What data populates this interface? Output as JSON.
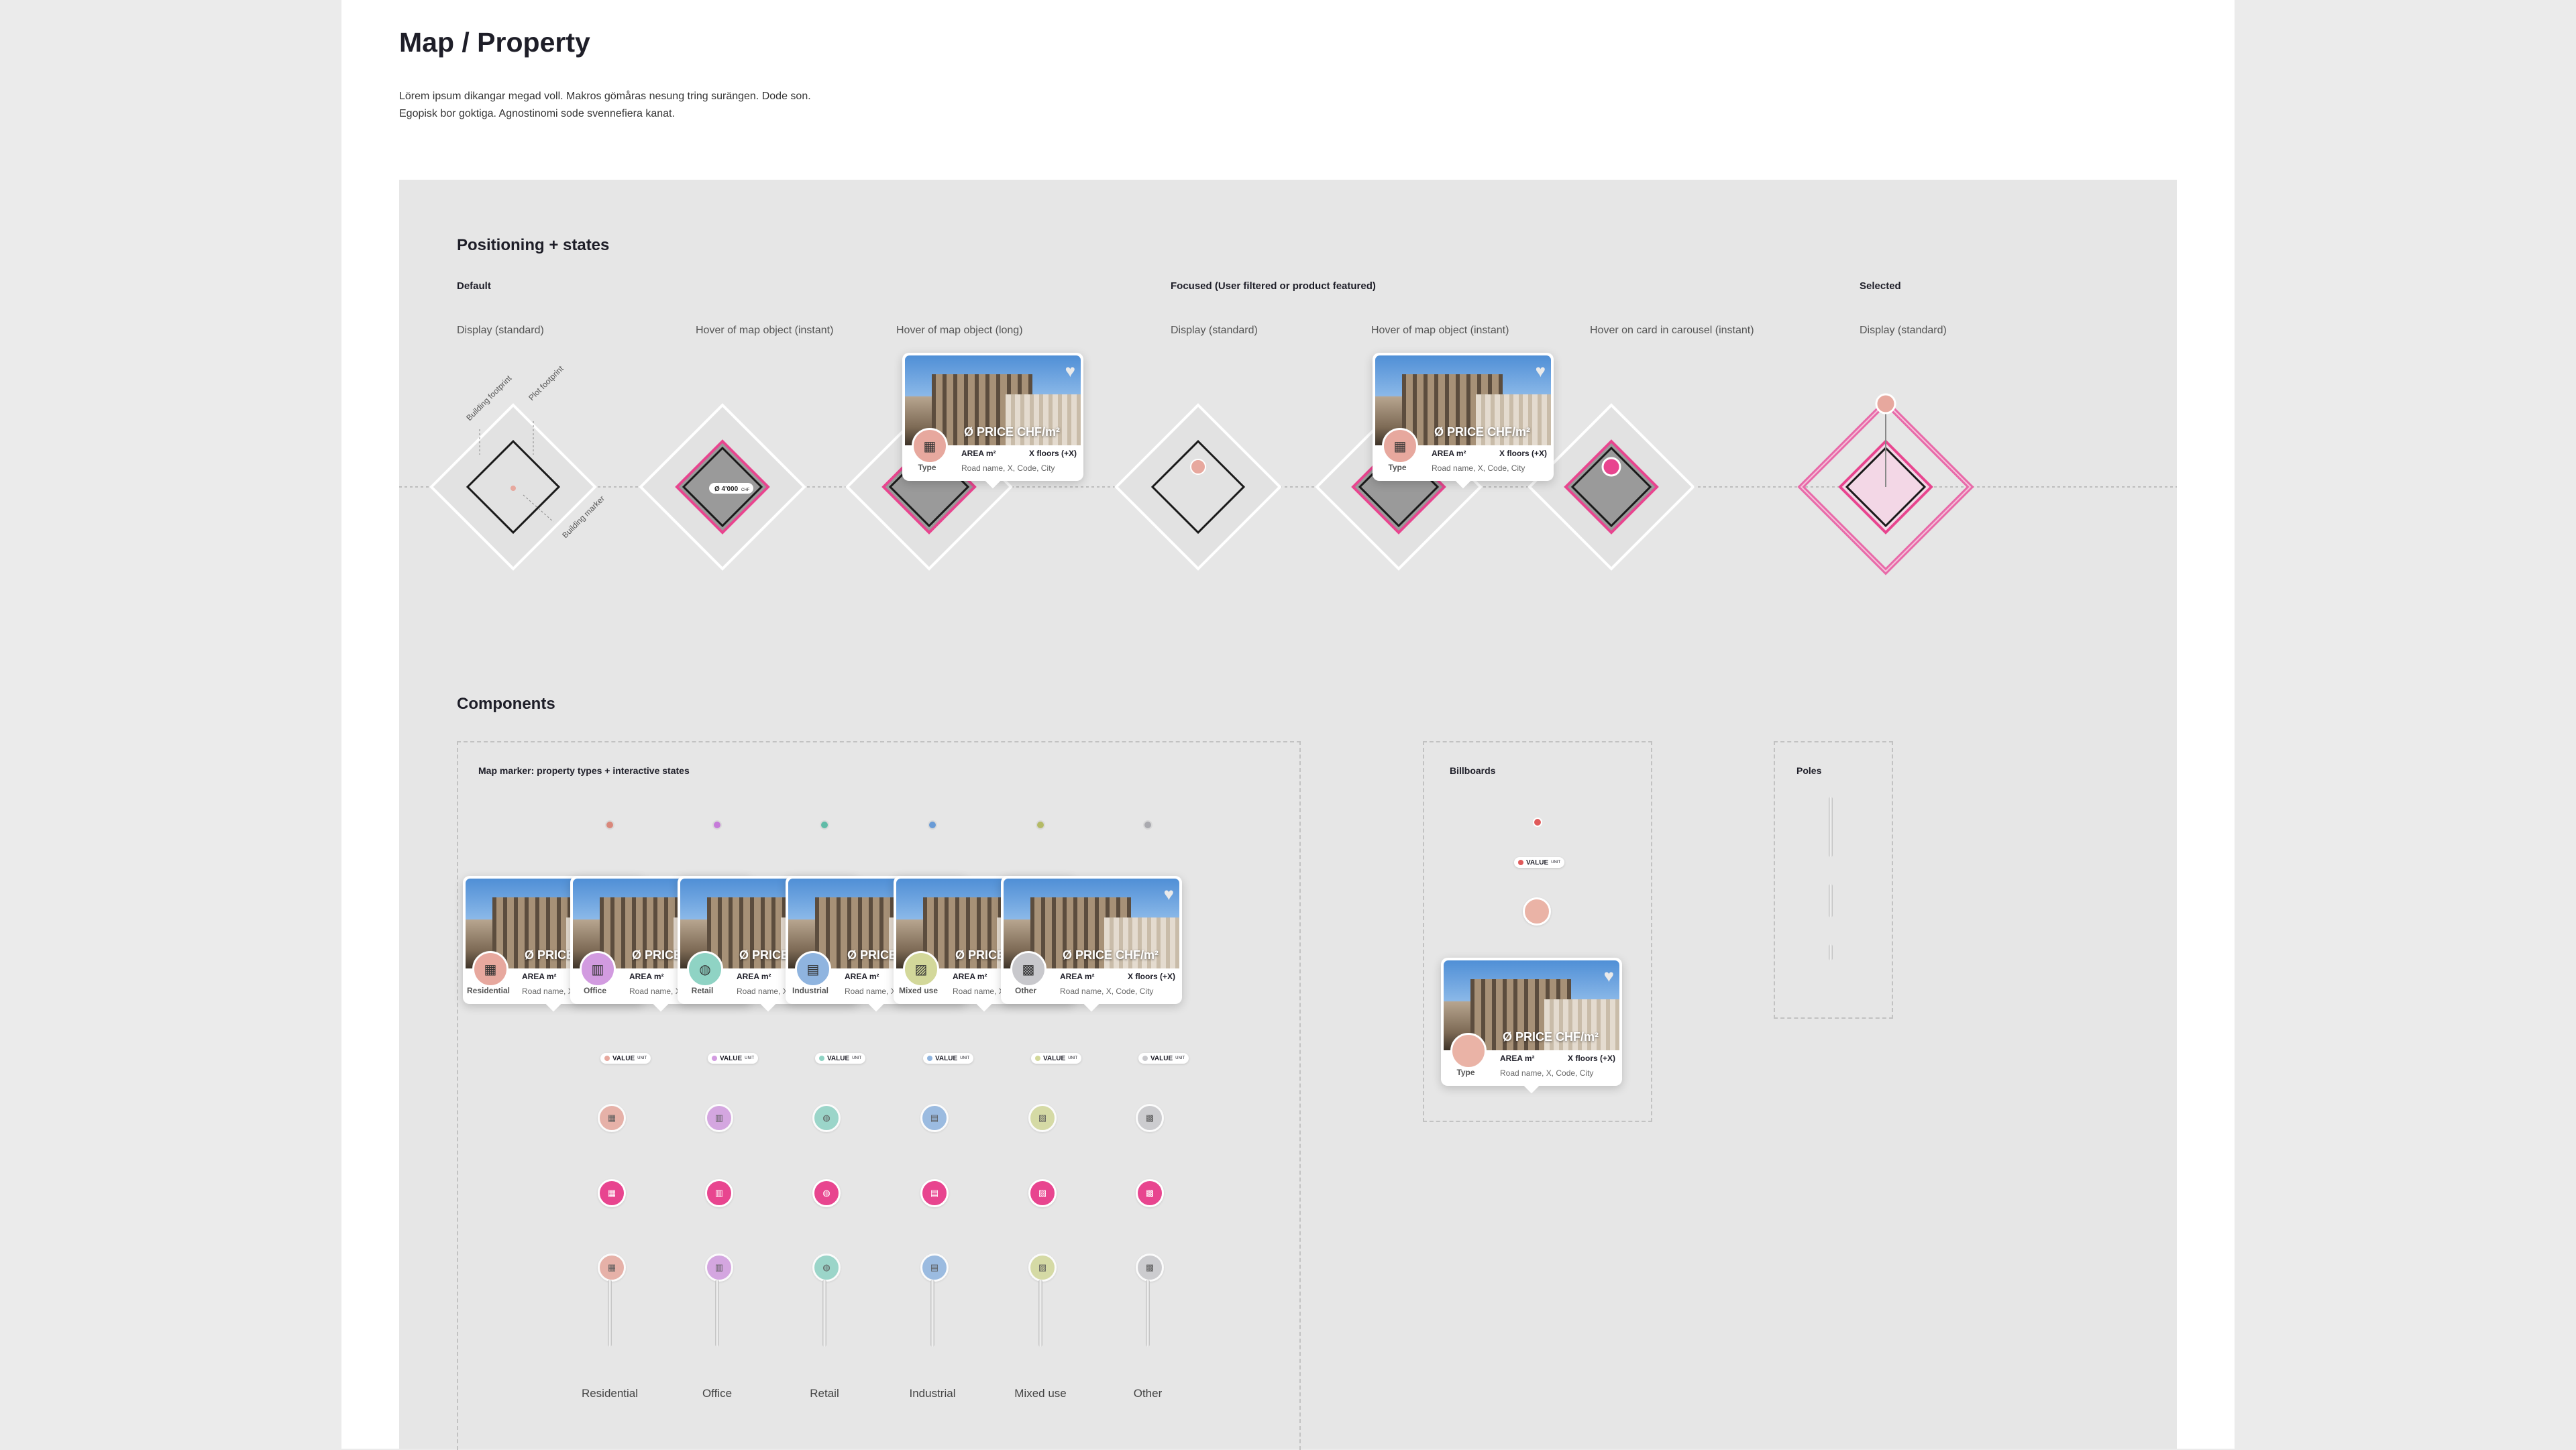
{
  "title": "Map / Property",
  "intro": [
    "Lörem ipsum dikangar megad voll. Makros gömåras nesung tring surängen. Dode son.",
    "Egopisk bor goktiga. Agnostinomi sode svennefiera kanat."
  ],
  "positioning": {
    "heading": "Positioning + states",
    "groups": [
      "Default",
      "Focused (User filtered or product featured)",
      "Selected"
    ],
    "states": [
      "Display (standard)",
      "Hover of map object (instant)",
      "Hover of map object (long)",
      "Display (standard)",
      "Hover of map object (instant)",
      "Hover on  card in carousel (instant)",
      "Display (standard)"
    ],
    "annotations": [
      "Building footprint",
      "Plot footprint",
      "Building marker"
    ],
    "hover_value": "Ø 4'000",
    "hover_unit": "CHF"
  },
  "card": {
    "price": "Ø PRICE CHF/m²",
    "area": "AREA m²",
    "floors": "X floors (+X)",
    "address": "Road name, X, Code, City",
    "type": "Type",
    "heart_icon": "heart-icon"
  },
  "components": {
    "heading": "Components",
    "marker_box_title": "Map marker: property types + interactive states",
    "billboards_title": "Billboards",
    "poles_title": "Poles",
    "pill_value": "VALUE",
    "pill_unit": "UNIT",
    "types": [
      {
        "name": "Residential",
        "color": "#e7a89e",
        "icon": "residential-icon"
      },
      {
        "name": "Office",
        "color": "#d29be0",
        "icon": "office-icon"
      },
      {
        "name": "Retail",
        "color": "#8fd3c4",
        "icon": "retail-icon"
      },
      {
        "name": "Industrial",
        "color": "#8fb4df",
        "icon": "industrial-icon"
      },
      {
        "name": "Mixed use",
        "color": "#d3d89a",
        "icon": "mixed-use-icon"
      },
      {
        "name": "Other",
        "color": "#c8c8cc",
        "icon": "other-icon"
      }
    ],
    "focus_color": "#e8458f",
    "selected_color": "#e86aa9"
  }
}
